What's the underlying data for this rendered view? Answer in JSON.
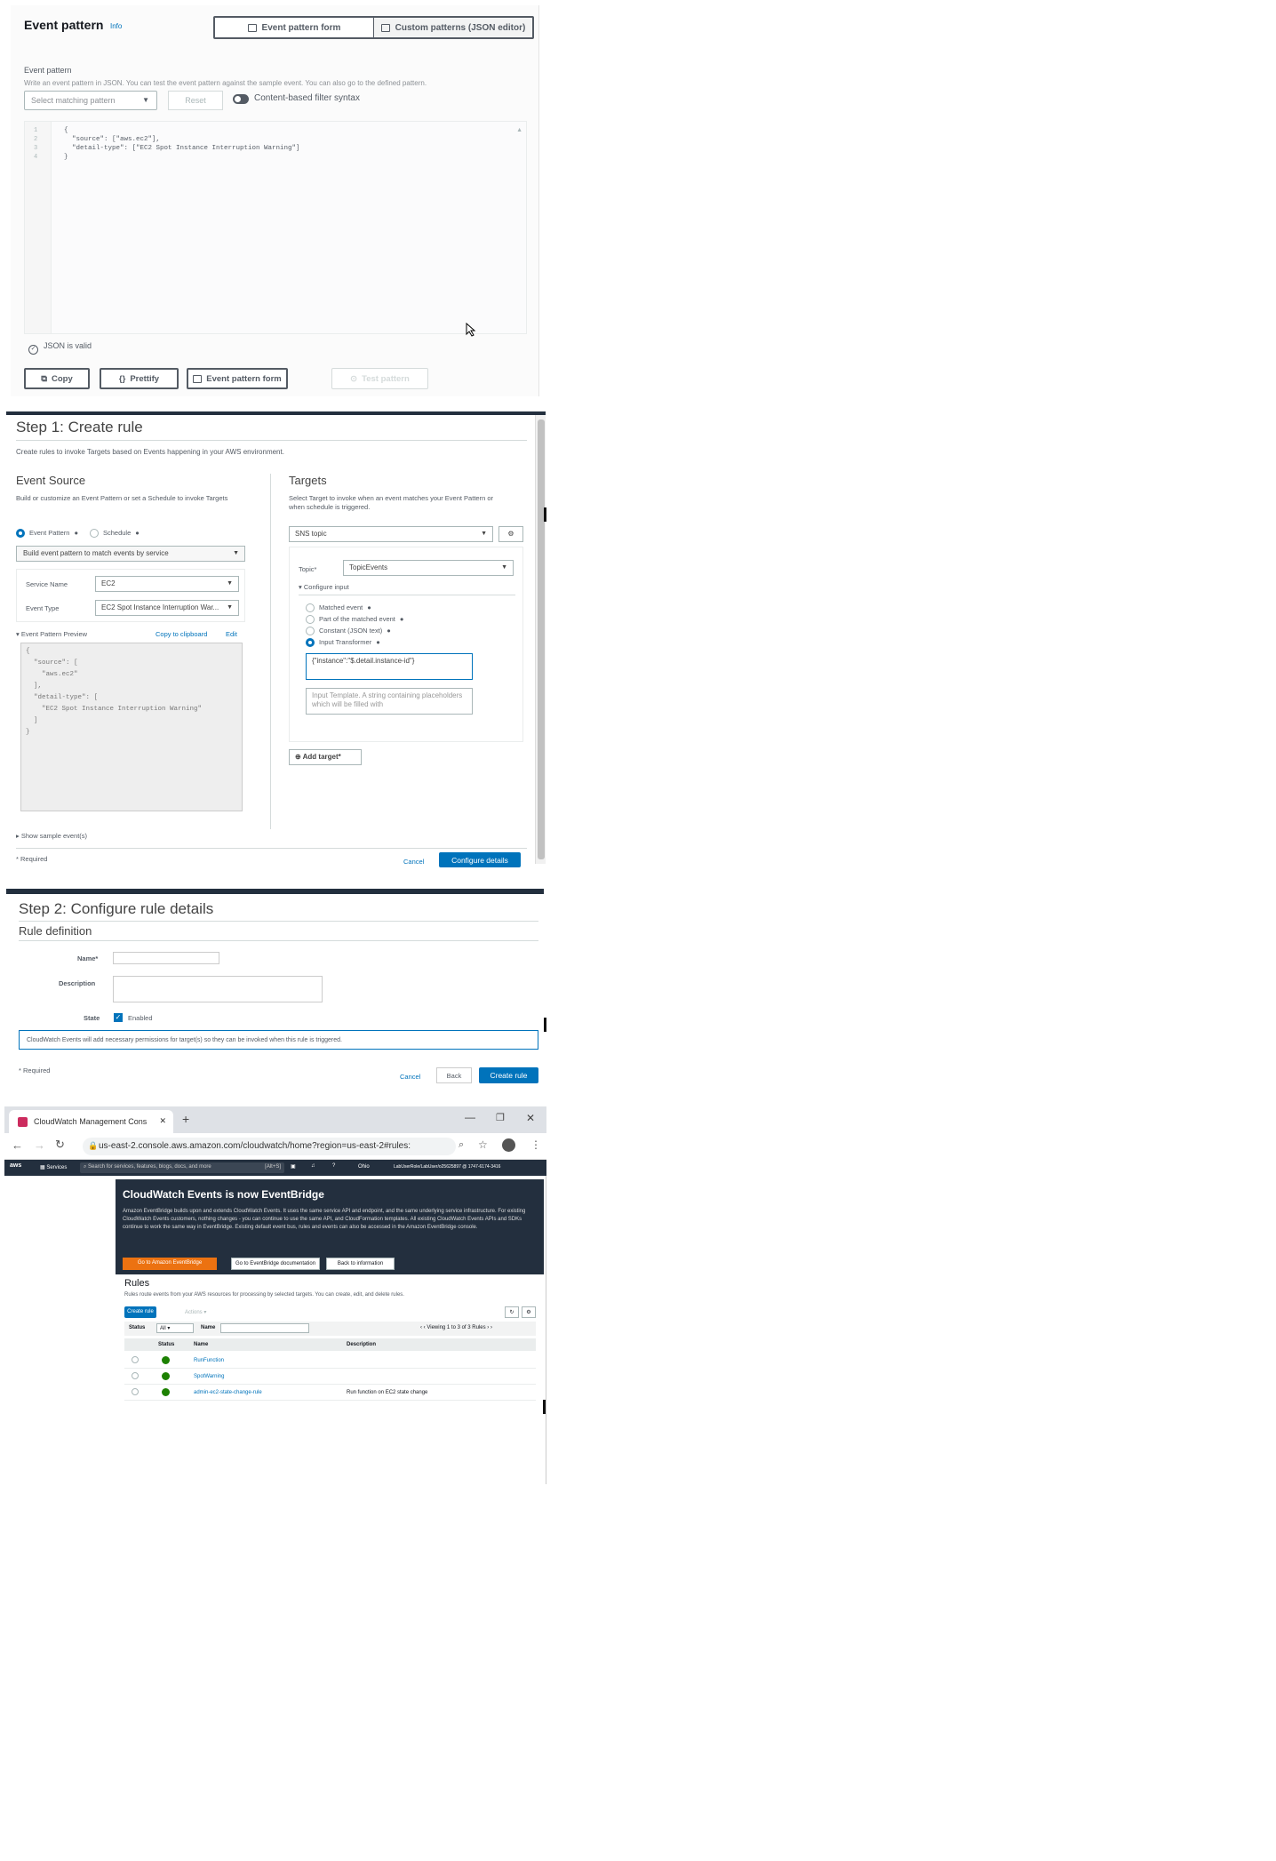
{
  "panel1": {
    "title": "Event pattern",
    "info": "Info",
    "seg_form": "Event pattern form",
    "seg_json": "Custom patterns (JSON editor)",
    "label": "Event pattern",
    "description": "Write an event pattern in JSON. You can test the event pattern against the sample event. You can also go to the defined pattern.",
    "select_placeholder": "Select matching pattern",
    "reset": "Reset",
    "toggle_label": "Content-based filter syntax",
    "code_lines": [
      "{",
      "  \"source\": [\"aws.ec2\"],",
      "  \"detail-type\": [\"EC2 Spot Instance Interruption Warning\"]",
      "}"
    ],
    "line_numbers": [
      "1",
      "2",
      "3",
      "4"
    ],
    "valid_text": "JSON is valid",
    "btn_copy": "Copy",
    "btn_prettify": "Prettify",
    "btn_form": "Event pattern form",
    "btn_test": "Test pattern"
  },
  "panel2": {
    "title": "Step 1: Create rule",
    "subtitle": "Create rules to invoke Targets based on Events happening in your AWS environment.",
    "event_source": "Event Source",
    "event_source_desc": "Build or customize an Event Pattern or set a Schedule to invoke Targets",
    "radio_pattern": "Event Pattern",
    "radio_schedule": "Schedule",
    "build_select": "Build event pattern to match events by service",
    "service_name_label": "Service Name",
    "service_name": "EC2",
    "event_type_label": "Event Type",
    "event_type": "EC2 Spot Instance Interruption War...",
    "preview_label": "Event Pattern Preview",
    "copy_clipboard": "Copy to clipboard",
    "edit": "Edit",
    "preview_lines": [
      "{",
      "  \"source\": [",
      "    \"aws.ec2\"",
      "  ],",
      "  \"detail-type\": [",
      "    \"EC2 Spot Instance Interruption Warning\"",
      "  ]",
      "}"
    ],
    "show_sample": "Show sample event(s)",
    "required": "* Required",
    "targets": "Targets",
    "targets_desc": "Select Target to invoke when an event matches your Event Pattern or when schedule is triggered.",
    "target_select": "SNS topic",
    "topic_label": "Topic*",
    "topic_value": "TopicEvents",
    "configure_input": "Configure input",
    "opt_matched": "Matched event",
    "opt_part": "Part of the matched event",
    "opt_constant": "Constant (JSON text)",
    "opt_transformer": "Input Transformer",
    "transformer_value": "{\"instance\":\"$.detail.instance-id\"}",
    "template_placeholder": "Input Template. A string containing placeholders which will be filled with",
    "add_target": "Add target*",
    "cancel": "Cancel",
    "configure_details": "Configure details"
  },
  "panel3": {
    "title": "Step 2: Configure rule details",
    "section": "Rule definition",
    "name_label": "Name*",
    "description_label": "Description",
    "state_label": "State",
    "enabled": "Enabled",
    "notice": "CloudWatch Events will add necessary permissions for target(s) so they can be invoked when this rule is triggered.",
    "required": "* Required",
    "cancel": "Cancel",
    "back": "Back",
    "create_rule": "Create rule"
  },
  "panel4": {
    "tab_title": "CloudWatch Management Cons",
    "url": "us-east-2.console.aws.amazon.com/cloudwatch/home?region=us-east-2#rules:",
    "aws_logo": "aws",
    "services": "Services",
    "search_placeholder": "Search for services, features, blogs, docs, and more",
    "shortcut": "[Alt+S]",
    "region": "Ohio",
    "account": "LabUserRole/LabUser/o25625897 @ 1747-6174-3416",
    "banner_title": "CloudWatch Events is now EventBridge",
    "banner_text": "Amazon EventBridge builds upon and extends CloudWatch Events. It uses the same service API and endpoint, and the same underlying service infrastructure. For existing CloudWatch Events customers, nothing changes - you can continue to use the same API, and CloudFormation templates. All existing CloudWatch Events APIs and SDKs continue to work the same way in EventBridge. Existing default event bus, rules and events can also be accessed in the Amazon EventBridge console.",
    "btn_go": "Go to Amazon EventBridge",
    "btn_docs": "Go to EventBridge documentation",
    "btn_back": "Back to information",
    "rules_title": "Rules",
    "rules_desc": "Rules route events from your AWS resources for processing by selected targets. You can create, edit, and delete rules.",
    "create_rule": "Create rule",
    "actions": "Actions",
    "status_filter_label": "Status",
    "status_filter": "All",
    "name_filter_label": "Name",
    "pager": "Viewing 1 to 3 of 3 Rules",
    "col_status": "Status",
    "col_name": "Name",
    "col_description": "Description",
    "rows": [
      {
        "name": "RunFunction",
        "description": ""
      },
      {
        "name": "SpotWarning",
        "description": ""
      },
      {
        "name": "admin-ec2-state-change-rule",
        "description": "Run function on EC2 state change"
      }
    ],
    "status_color": "#1d8102"
  },
  "colors": {
    "accent": "#0073bb",
    "navy": "#232f3e",
    "orange": "#ec7211"
  }
}
